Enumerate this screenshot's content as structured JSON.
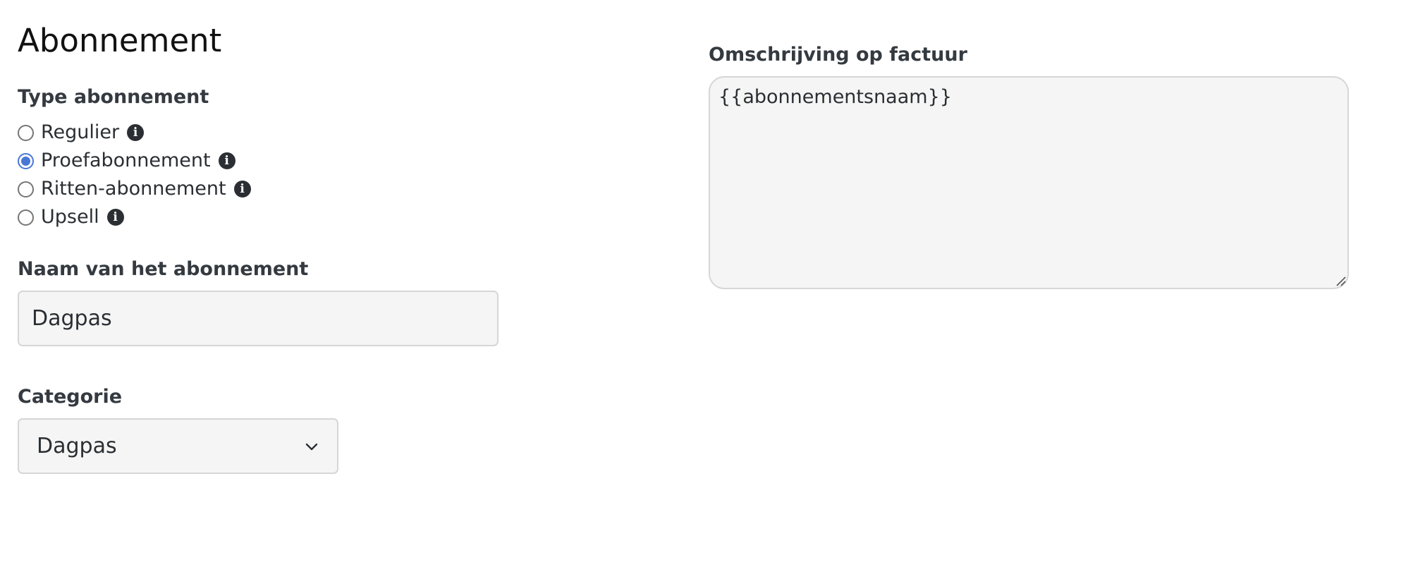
{
  "page": {
    "title": "Abonnement"
  },
  "type_section": {
    "label": "Type abonnement",
    "options": [
      {
        "label": "Regulier",
        "checked": false,
        "info_icon": "info-icon"
      },
      {
        "label": "Proefabonnement",
        "checked": true,
        "info_icon": "info-icon"
      },
      {
        "label": "Ritten-abonnement",
        "checked": false,
        "info_icon": "info-icon"
      },
      {
        "label": "Upsell",
        "checked": false,
        "info_icon": "info-icon"
      }
    ]
  },
  "name_field": {
    "label": "Naam van het abonnement",
    "value": "Dagpas"
  },
  "category_field": {
    "label": "Categorie",
    "selected": "Dagpas",
    "icon": "chevron-down-icon"
  },
  "description_field": {
    "label": "Omschrijving op factuur",
    "value": "{{abonnementsnaam}}"
  },
  "colors": {
    "accent": "#4a77d4",
    "input_background": "#f5f5f5",
    "input_border": "#d6d6d6",
    "text": "#2b2f33"
  }
}
